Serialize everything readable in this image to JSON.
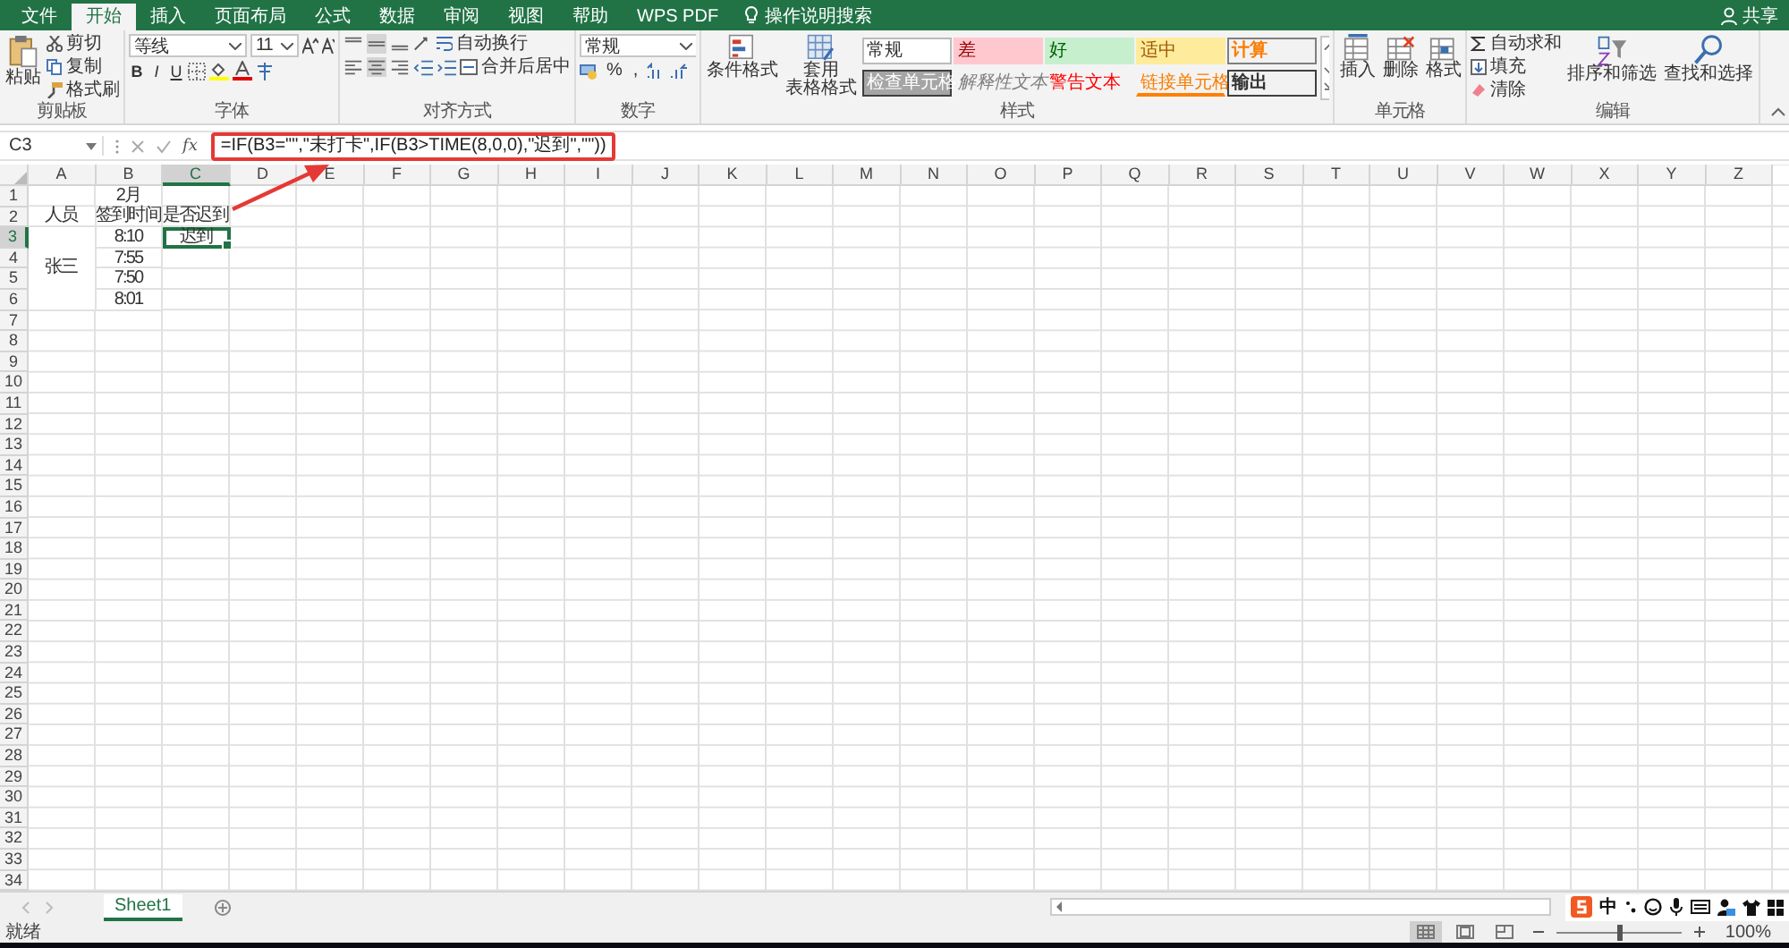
{
  "title_bar": {
    "tabs": [
      {
        "label": "文件",
        "selected": false
      },
      {
        "label": "开始",
        "selected": true
      },
      {
        "label": "插入",
        "selected": false
      },
      {
        "label": "页面布局",
        "selected": false
      },
      {
        "label": "公式",
        "selected": false
      },
      {
        "label": "数据",
        "selected": false
      },
      {
        "label": "审阅",
        "selected": false
      },
      {
        "label": "视图",
        "selected": false
      },
      {
        "label": "帮助",
        "selected": false
      },
      {
        "label": "WPS PDF",
        "selected": false
      }
    ],
    "search": {
      "placeholder": "操作说明搜索"
    },
    "share": "共享"
  },
  "ribbon": {
    "groups": [
      {
        "kind": "clipboard",
        "label": "剪贴板",
        "paste": "粘贴",
        "items": [
          "剪切",
          "复制",
          "格式刷"
        ]
      },
      {
        "kind": "font",
        "label": "字体",
        "font": "等线",
        "size": "11",
        "styles": [
          "B",
          "I",
          "U"
        ]
      },
      {
        "kind": "alignment",
        "label": "对齐方式",
        "wrap": "自动换行",
        "merge": "合并后居中"
      },
      {
        "kind": "number",
        "label": "数字",
        "format": "常规",
        "symbols": [
          "%",
          ","
        ]
      },
      {
        "kind": "styles",
        "label": "样式",
        "buttons": [
          [
            "条件格式"
          ],
          [
            "套用",
            "表格格式"
          ]
        ],
        "cells": [
          {
            "kind": "normal",
            "label": "常规"
          },
          {
            "kind": "bad",
            "label": "差"
          },
          {
            "kind": "good",
            "label": "好"
          },
          {
            "kind": "neutral",
            "label": "适中"
          },
          {
            "kind": "calculation",
            "label": "计算"
          },
          {
            "kind": "check",
            "label": "检查单元格"
          },
          {
            "kind": "explanatory",
            "label": "解释性文本"
          },
          {
            "kind": "warning",
            "label": "警告文本"
          },
          {
            "kind": "linked",
            "label": "链接单元格"
          },
          {
            "kind": "output",
            "label": "输出"
          }
        ]
      },
      {
        "kind": "cells",
        "label": "单元格",
        "buttons": [
          "插入",
          "删除",
          "格式"
        ]
      },
      {
        "kind": "editing",
        "label": "编辑",
        "items": [
          "自动求和",
          "填充",
          "清除"
        ],
        "buttons": [
          "排序和筛选",
          "查找和选择"
        ]
      }
    ]
  },
  "formula_bar": {
    "name_box": "C3",
    "fx": "fx",
    "formula": "=IF(B3=\"\",\"未打卡\",IF(B3>TIME(8,0,0),\"迟到\",\"\"))"
  },
  "sheet": {
    "columns": [
      "A",
      "B",
      "C",
      "D",
      "E",
      "F",
      "G",
      "H",
      "I",
      "J",
      "K",
      "L",
      "M",
      "N",
      "O",
      "P",
      "Q",
      "R",
      "S",
      "T",
      "U",
      "V",
      "W",
      "X",
      "Y",
      "Z"
    ],
    "rows": [
      {
        "number": "1",
        "cells": {
          "B": {
            "text": "2月",
            "selected": false
          }
        }
      },
      {
        "number": "2",
        "cells": {
          "A": {
            "text": "人员",
            "selected": false
          },
          "B": {
            "text": "签到时间",
            "selected": false
          },
          "C": {
            "text": "是否迟到",
            "selected": false
          }
        }
      },
      {
        "number": "3",
        "cells": {
          "A": {
            "text": "张三",
            "selected": false,
            "merged": true
          },
          "B": {
            "text": "8:10",
            "selected": false
          },
          "C": {
            "text": "迟到",
            "selected": true
          }
        }
      },
      {
        "number": "4",
        "cells": {
          "B": {
            "text": "7:55",
            "selected": false
          }
        }
      },
      {
        "number": "5",
        "cells": {
          "B": {
            "text": "7:50",
            "selected": false
          }
        }
      },
      {
        "number": "6",
        "cells": {
          "B": {
            "text": "8:01",
            "selected": false
          }
        }
      },
      {
        "number": "7"
      },
      {
        "number": "8"
      },
      {
        "number": "9"
      },
      {
        "number": "10"
      },
      {
        "number": "11"
      },
      {
        "number": "12"
      },
      {
        "number": "13"
      },
      {
        "number": "14"
      },
      {
        "number": "15"
      },
      {
        "number": "16"
      },
      {
        "number": "17"
      },
      {
        "number": "18"
      },
      {
        "number": "19"
      },
      {
        "number": "20"
      },
      {
        "number": "21"
      },
      {
        "number": "22"
      },
      {
        "number": "23"
      },
      {
        "number": "24"
      },
      {
        "number": "25"
      },
      {
        "number": "26"
      },
      {
        "number": "27"
      },
      {
        "number": "28"
      },
      {
        "number": "29"
      },
      {
        "number": "30"
      },
      {
        "number": "31"
      },
      {
        "number": "32"
      },
      {
        "number": "33"
      },
      {
        "number": "34"
      }
    ]
  },
  "sheet_tabs": [
    {
      "label": "Sheet1",
      "selected": true
    }
  ],
  "ime": {
    "mode": "中"
  },
  "status_bar": {
    "status": "就绪",
    "views": [
      {
        "kind": "normal",
        "selected": true
      },
      {
        "kind": "layout",
        "selected": false
      },
      {
        "kind": "break",
        "selected": false
      }
    ],
    "zoom": {
      "reading": "100%",
      "level": 0.5
    }
  }
}
